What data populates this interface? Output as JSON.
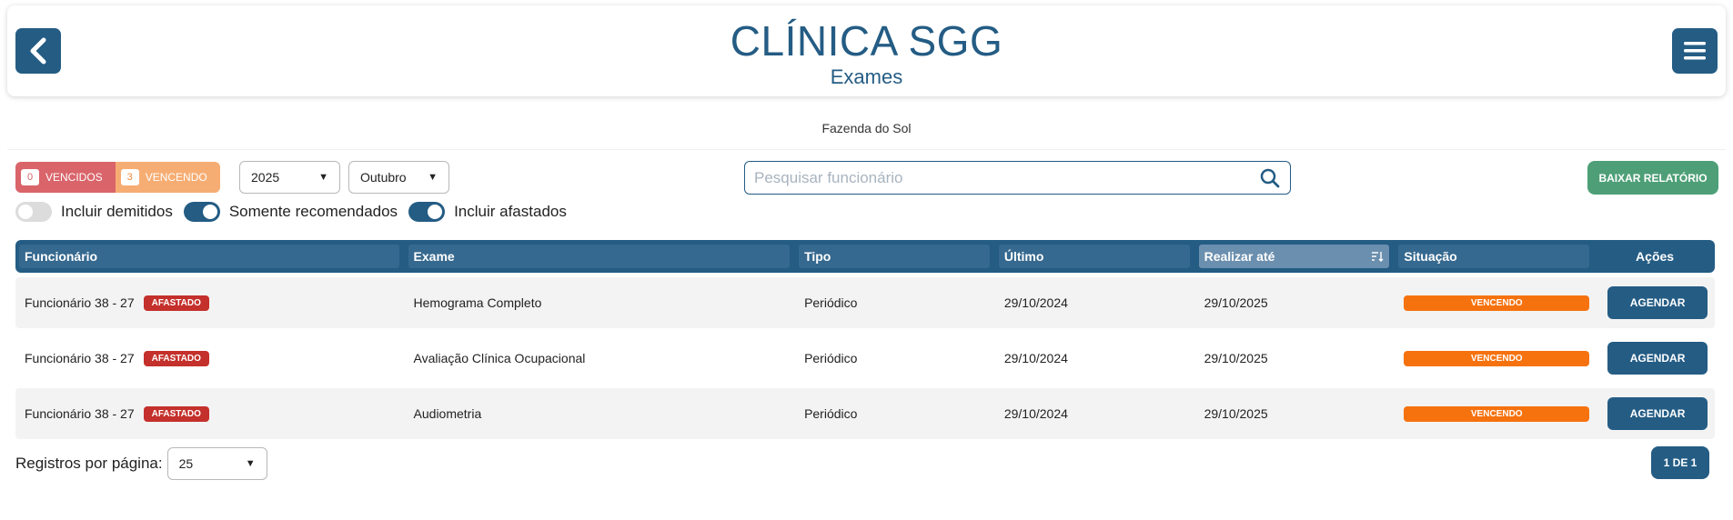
{
  "header": {
    "title": "CLÍNICA SGG",
    "subtitle": "Exames",
    "back_icon": "chevron-left-icon",
    "menu_icon": "hamburger-menu-icon"
  },
  "company": "Fazenda do Sol",
  "filters": {
    "vencidos": {
      "count": "0",
      "label": "VENCIDOS"
    },
    "vencendo": {
      "count": "3",
      "label": "VENCENDO"
    },
    "year": "2025",
    "month": "Outubro",
    "search_placeholder": "Pesquisar funcionário",
    "search_value": "",
    "report_button": "BAIXAR RELATÓRIO"
  },
  "toggles": [
    {
      "label": "Incluir demitidos",
      "on": false
    },
    {
      "label": "Somente recomendados",
      "on": true
    },
    {
      "label": "Incluir afastados",
      "on": true
    }
  ],
  "table": {
    "columns": [
      "Funcionário",
      "Exame",
      "Tipo",
      "Último",
      "Realizar até",
      "Situação",
      "Ações"
    ],
    "sorted_column": "Realizar até",
    "rows": [
      {
        "funcionario": "Funcionário 38 - 27",
        "tag": "AFASTADO",
        "exame": "Hemograma Completo",
        "tipo": "Periódico",
        "ultimo": "29/10/2024",
        "realizar_ate": "29/10/2025",
        "situacao": "VENCENDO",
        "acao": "AGENDAR"
      },
      {
        "funcionario": "Funcionário 38 - 27",
        "tag": "AFASTADO",
        "exame": "Avaliação Clínica Ocupacional",
        "tipo": "Periódico",
        "ultimo": "29/10/2024",
        "realizar_ate": "29/10/2025",
        "situacao": "VENCENDO",
        "acao": "AGENDAR"
      },
      {
        "funcionario": "Funcionário 38 - 27",
        "tag": "AFASTADO",
        "exame": "Audiometria",
        "tipo": "Periódico",
        "ultimo": "29/10/2024",
        "realizar_ate": "29/10/2025",
        "situacao": "VENCENDO",
        "acao": "AGENDAR"
      }
    ]
  },
  "pagination": {
    "per_page_label": "Registros por página:",
    "per_page_value": "25",
    "page_label": "1 DE 1"
  },
  "colors": {
    "primary": "#245c84",
    "vencidos": "#d9646a",
    "vencendo": "#f6ad73",
    "status_vencendo": "#f6720f",
    "afastado": "#c4302b",
    "report": "#4e9f77"
  }
}
